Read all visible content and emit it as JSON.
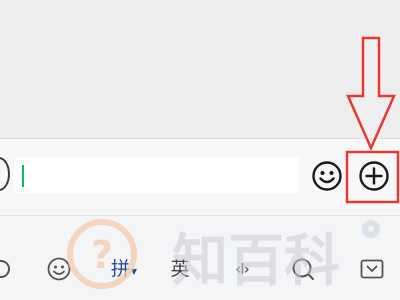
{
  "input_bar": {
    "text_value": "",
    "emoji_icon": "smiley-icon",
    "plus_icon": "plus-circle-icon"
  },
  "annotation": {
    "icon": "arrow-down-icon",
    "color": "#e53935"
  },
  "keyboard_toolbar": {
    "items": [
      {
        "icon": "smiley-icon"
      },
      {
        "label": "拼"
      },
      {
        "label": "英"
      },
      {
        "label": "‹I›"
      },
      {
        "icon": "search-icon"
      },
      {
        "icon": "keyboard-hide-icon"
      }
    ]
  },
  "watermark": {
    "text": "知百科"
  },
  "colors": {
    "cursor": "#07c160",
    "accent_pinyin": "#2c4a9a",
    "annotation_red": "#e53935"
  }
}
